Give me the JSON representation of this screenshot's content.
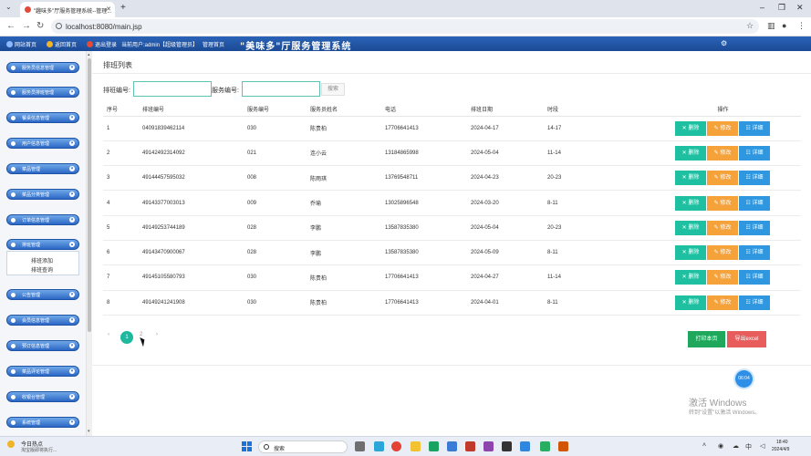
{
  "browser": {
    "tab_title": "\"趣味多\"厅服务管理系统--管理...",
    "url": "localhost:8080/main.jsp"
  },
  "header": {
    "items": [
      "网站首页",
      "返回首页",
      "退出登录",
      "当前用户:admin【超级管理员】",
      "管理首页"
    ],
    "title": "\"美味多\"厅服务管理系统"
  },
  "sidebar": {
    "items": [
      "服务员信息管理",
      "服务员排班管理",
      "餐桌信息管理",
      "用户信息管理",
      "菜品管理",
      "菜品分类管理",
      "订单信息管理",
      "排班管理",
      "公告管理",
      "会员信息管理",
      "预订信息管理",
      "菜品评论管理",
      "收银台管理",
      "系统管理"
    ],
    "expanded_item": "排班管理",
    "subitems": [
      "排班添加",
      "排班查询"
    ]
  },
  "main": {
    "page_title": "排班列表",
    "search": {
      "label1": "排班编号:",
      "label2": "服务编号:",
      "value1": "",
      "value2": "",
      "button": "搜索"
    },
    "table": {
      "headers": [
        "序号",
        "排班编号",
        "服务编号",
        "服务员姓名",
        "电话",
        "排班日期",
        "时段",
        "操作"
      ],
      "rows": [
        [
          "1",
          "04091839462114",
          "030",
          "陈贵柏",
          "17706641413",
          "2024-04-17",
          "14-17"
        ],
        [
          "2",
          "49142492314092",
          "021",
          "连小云",
          "13184865998",
          "2024-05-04",
          "11-14"
        ],
        [
          "3",
          "49144457595032",
          "008",
          "陈雨琪",
          "13769548711",
          "2024-04-23",
          "20-23"
        ],
        [
          "4",
          "49143377003013",
          "009",
          "乔瑜",
          "13025896548",
          "2024-03-20",
          "8-11"
        ],
        [
          "5",
          "49149253744189",
          "028",
          "李鹏",
          "13587835380",
          "2024-05-04",
          "20-23"
        ],
        [
          "6",
          "49143470900067",
          "028",
          "李鹏",
          "13587835380",
          "2024-05-09",
          "8-11"
        ],
        [
          "7",
          "49145105580793",
          "030",
          "陈贵柏",
          "17706641413",
          "2024-04-27",
          "11-14"
        ],
        [
          "8",
          "49149241241908",
          "030",
          "陈贵柏",
          "17706641413",
          "2024-04-01",
          "8-11"
        ]
      ],
      "op_delete": "✕ 删除",
      "op_edit": "✎ 修改",
      "op_detail": "☷ 详细"
    },
    "pagination": {
      "prev": "‹",
      "current": "1",
      "next_page": "2",
      "next": "›"
    },
    "print_button": "打印本页",
    "excel_button": "导出excel"
  },
  "float_badge": "06:04",
  "watermark": {
    "line1": "激活 Windows",
    "line2": "转到\"设置\"以激活 Windows。"
  },
  "taskbar": {
    "weather1": "今日热点",
    "weather2": "淘宝版即将执行...",
    "search": "搜索",
    "time": "18:40",
    "date": "2024/4/9"
  }
}
